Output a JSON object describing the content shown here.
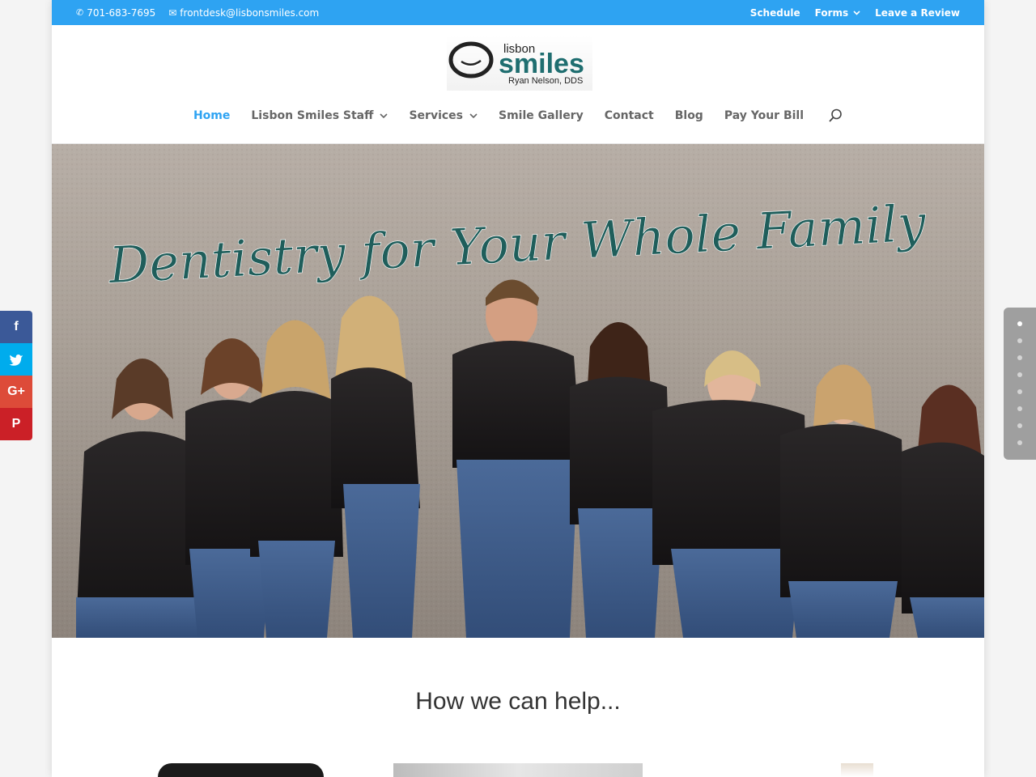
{
  "topbar": {
    "phone": "701-683-7695",
    "email": "frontdesk@lisbonsmiles.com",
    "links": [
      {
        "label": "Schedule",
        "dropdown": false
      },
      {
        "label": "Forms",
        "dropdown": true
      },
      {
        "label": "Leave a Review",
        "dropdown": false
      }
    ]
  },
  "logo": {
    "small": "lisbon",
    "main": "smiles",
    "sub": "Ryan Nelson, DDS"
  },
  "nav": {
    "items": [
      {
        "label": "Home",
        "active": true,
        "dropdown": false
      },
      {
        "label": "Lisbon Smiles Staff",
        "active": false,
        "dropdown": true
      },
      {
        "label": "Services",
        "active": false,
        "dropdown": true
      },
      {
        "label": "Smile Gallery",
        "active": false,
        "dropdown": false
      },
      {
        "label": "Contact",
        "active": false,
        "dropdown": false
      },
      {
        "label": "Blog",
        "active": false,
        "dropdown": false
      },
      {
        "label": "Pay Your Bill",
        "active": false,
        "dropdown": false
      }
    ],
    "search_icon": "search-icon"
  },
  "hero": {
    "headline": "Dentistry for Your Whole Family",
    "headline_color": "#1f5e5b"
  },
  "section": {
    "title": "How we can help..."
  },
  "social": [
    {
      "name": "facebook",
      "glyph": "f",
      "color": "#3b5998"
    },
    {
      "name": "twitter",
      "glyph": "t",
      "color": "#00aced"
    },
    {
      "name": "google-plus",
      "glyph": "G+",
      "color": "#dd4b39"
    },
    {
      "name": "pinterest",
      "glyph": "P",
      "color": "#cb2027"
    }
  ],
  "slider": {
    "dot_count": 8,
    "active_index": 0
  },
  "colors": {
    "accent": "#2ea3f2",
    "nav_text": "#666666"
  }
}
